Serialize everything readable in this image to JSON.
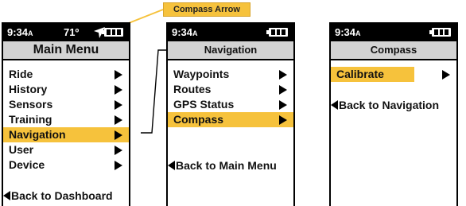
{
  "callout": {
    "label": "Compass Arrow"
  },
  "screens": [
    {
      "status": {
        "time": "9:34",
        "time_suffix": "A",
        "temperature": "71º",
        "icons": [
          "compass-arrow-icon",
          "battery-icon"
        ]
      },
      "title": "Main Menu",
      "items": [
        {
          "label": "Ride",
          "selected": false
        },
        {
          "label": "History",
          "selected": false
        },
        {
          "label": "Sensors",
          "selected": false
        },
        {
          "label": "Training",
          "selected": false
        },
        {
          "label": "Navigation",
          "selected": true
        },
        {
          "label": "User",
          "selected": false
        },
        {
          "label": "Device",
          "selected": false
        }
      ],
      "back": "Back to Dashboard"
    },
    {
      "status": {
        "time": "9:34",
        "time_suffix": "A",
        "icons": [
          "battery-icon"
        ]
      },
      "title": "Navigation",
      "items": [
        {
          "label": "Waypoints",
          "selected": false
        },
        {
          "label": "Routes",
          "selected": false
        },
        {
          "label": "GPS Status",
          "selected": false
        },
        {
          "label": "Compass",
          "selected": true
        }
      ],
      "back": "Back to Main Menu"
    },
    {
      "status": {
        "time": "9:34",
        "time_suffix": "A",
        "icons": [
          "battery-icon"
        ]
      },
      "title": "Compass",
      "items": [
        {
          "label": "Calibrate",
          "selected": true
        }
      ],
      "back": "Back to Navigation"
    }
  ],
  "colors": {
    "highlight": "#f6c23c",
    "title_bar": "#d3d3d3",
    "status_bar": "#000000"
  }
}
